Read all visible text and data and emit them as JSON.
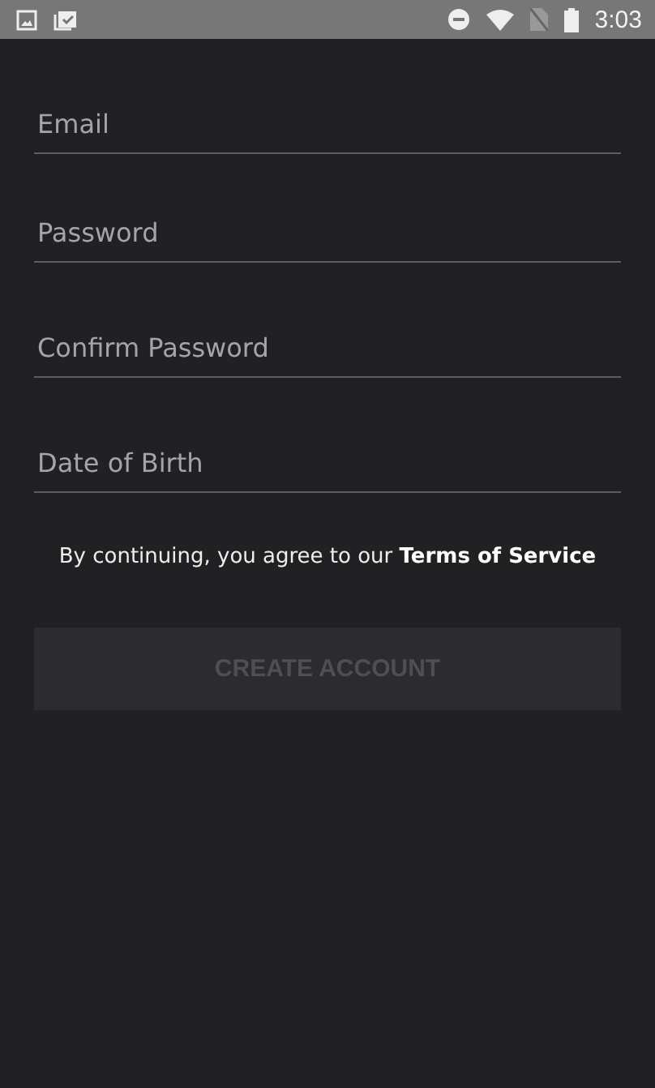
{
  "status_bar": {
    "time": "3:03"
  },
  "fields": [
    {
      "placeholder": "Email"
    },
    {
      "placeholder": "Password"
    },
    {
      "placeholder": "Confirm Password"
    },
    {
      "placeholder": "Date of Birth"
    }
  ],
  "terms": {
    "text": "By continuing, you agree to our",
    "link": "Terms of Service"
  },
  "button": {
    "label": "CREATE ACCOUNT",
    "disabled": true
  }
}
